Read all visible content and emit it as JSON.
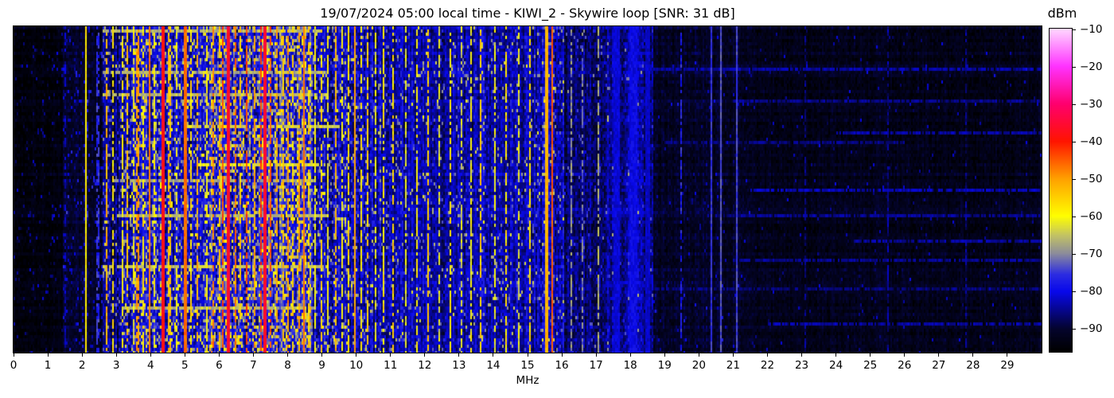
{
  "title": "19/07/2024 05:00 local time - KIWI_2 - Skywire loop [SNR: 31 dB]",
  "x_axis": {
    "label": "MHz",
    "ticks": [
      "0",
      "1",
      "2",
      "3",
      "4",
      "5",
      "6",
      "7",
      "8",
      "9",
      "10",
      "11",
      "12",
      "13",
      "14",
      "15",
      "16",
      "17",
      "18",
      "19",
      "20",
      "21",
      "22",
      "23",
      "24",
      "25",
      "26",
      "27",
      "28",
      "29"
    ]
  },
  "colorbar": {
    "label": "dBm",
    "ticks": [
      "−10",
      "−20",
      "−30",
      "−40",
      "−50",
      "−60",
      "−70",
      "−80",
      "−90"
    ]
  },
  "chart_data": {
    "type": "heatmap",
    "title": "19/07/2024 05:00 local time - KIWI_2 - Skywire loop [SNR: 31 dB]",
    "xlabel": "MHz",
    "colorbar_label": "dBm",
    "x_range": [
      0,
      30
    ],
    "value_range_dbm": [
      -96,
      -10
    ],
    "colorbar_tick_values": [
      -10,
      -20,
      -30,
      -40,
      -50,
      -60,
      -70,
      -80,
      -90
    ],
    "grid": false,
    "description": "HF waterfall spectrogram 0-30 MHz. Quiet/dark below 1.5 MHz and above 18.7 MHz; dense strong broadcast/ham signals 2.6-8.7 MHz (yellow/orange/red, strongest ~4.3, 6.3 and 7.3 MHz); moderate blue noise with many narrow carriers 8.7-18.6 MHz; sparse faint horizontal interference streaks 18.5-30 MHz.",
    "cols": 646,
    "rows": 103,
    "seed": 1234567,
    "colormap_stops": [
      [
        0.0,
        0,
        0,
        0
      ],
      [
        0.07,
        4,
        4,
        45
      ],
      [
        0.186,
        8,
        8,
        235
      ],
      [
        0.24,
        45,
        45,
        225
      ],
      [
        0.304,
        140,
        140,
        155
      ],
      [
        0.36,
        195,
        195,
        100
      ],
      [
        0.42,
        255,
        255,
        0
      ],
      [
        0.536,
        255,
        160,
        0
      ],
      [
        0.652,
        255,
        20,
        0
      ],
      [
        0.768,
        255,
        0,
        110
      ],
      [
        0.884,
        255,
        50,
        255
      ],
      [
        1.0,
        255,
        215,
        255
      ]
    ],
    "noise_bands": [
      {
        "from": 0.0,
        "to": 1.45,
        "base": -94.0,
        "col_var": 1.0,
        "noise": 1.8,
        "spike_p": 0.05,
        "spike_amp": 8
      },
      {
        "from": 1.45,
        "to": 2.05,
        "base": -90.5,
        "col_var": 1.5,
        "noise": 2.5,
        "spike_p": 0.1,
        "spike_amp": 9
      },
      {
        "from": 2.05,
        "to": 2.6,
        "base": -91.0,
        "col_var": 1.5,
        "noise": 2.5,
        "spike_p": 0.09,
        "spike_amp": 10
      },
      {
        "from": 2.6,
        "to": 3.15,
        "base": -86.0,
        "col_var": 3.0,
        "noise": 4.0,
        "spike_p": 0.16,
        "spike_amp": 12
      },
      {
        "from": 3.15,
        "to": 4.65,
        "base": -81.0,
        "col_var": 5.0,
        "noise": 5.0,
        "spike_p": 0.25,
        "spike_amp": 14
      },
      {
        "from": 4.65,
        "to": 5.55,
        "base": -82.0,
        "col_var": 5.0,
        "noise": 5.0,
        "spike_p": 0.22,
        "spike_amp": 14
      },
      {
        "from": 5.55,
        "to": 7.75,
        "base": -79.0,
        "col_var": 6.0,
        "noise": 6.0,
        "spike_p": 0.3,
        "spike_amp": 14
      },
      {
        "from": 7.75,
        "to": 8.7,
        "base": -78.0,
        "col_var": 6.0,
        "noise": 6.0,
        "spike_p": 0.32,
        "spike_amp": 14
      },
      {
        "from": 8.7,
        "to": 10.2,
        "base": -82.0,
        "col_var": 4.0,
        "noise": 5.0,
        "spike_p": 0.18,
        "spike_amp": 13
      },
      {
        "from": 10.2,
        "to": 11.2,
        "base": -82.5,
        "col_var": 4.0,
        "noise": 4.5,
        "spike_p": 0.12,
        "spike_amp": 12
      },
      {
        "from": 11.2,
        "to": 15.35,
        "base": -83.5,
        "col_var": 3.5,
        "noise": 4.0,
        "spike_p": 0.09,
        "spike_amp": 12
      },
      {
        "from": 15.35,
        "to": 16.05,
        "base": -82.0,
        "col_var": 4.0,
        "noise": 5.0,
        "spike_p": 0.12,
        "spike_amp": 12
      },
      {
        "from": 16.05,
        "to": 17.25,
        "base": -86.5,
        "col_var": 3.0,
        "noise": 4.0,
        "spike_p": 0.05,
        "spike_amp": 10
      },
      {
        "from": 17.25,
        "to": 18.65,
        "base": -84.0,
        "col_var": 3.0,
        "noise": 4.0,
        "spike_p": 0.04,
        "spike_amp": 9
      },
      {
        "from": 18.65,
        "to": 21.3,
        "base": -91.0,
        "col_var": 1.5,
        "noise": 2.5,
        "spike_p": 0.02,
        "spike_amp": 8
      },
      {
        "from": 21.3,
        "to": 30.0,
        "base": -92.5,
        "col_var": 1.2,
        "noise": 2.2,
        "spike_p": 0.015,
        "spike_amp": 8
      }
    ],
    "signals": [
      {
        "f": 1.51,
        "w": 0.06,
        "level": -83,
        "solid": 0
      },
      {
        "f": 2.1,
        "w": 0.06,
        "level": -58,
        "solid": 1
      },
      {
        "f": 2.46,
        "w": 0.05,
        "level": -76,
        "solid": 0
      },
      {
        "f": 2.71,
        "w": 0.05,
        "level": -52,
        "solid": 0
      },
      {
        "f": 2.9,
        "w": 0.04,
        "level": -57,
        "solid": 0
      },
      {
        "f": 3.2,
        "w": 0.05,
        "level": -59,
        "solid": 0
      },
      {
        "f": 3.33,
        "w": 0.04,
        "level": -54,
        "solid": 0
      },
      {
        "f": 3.5,
        "w": 0.05,
        "level": -61,
        "solid": 0
      },
      {
        "f": 3.62,
        "w": 0.06,
        "level": -50,
        "solid": 0
      },
      {
        "f": 3.8,
        "w": 0.05,
        "level": -57,
        "solid": 0
      },
      {
        "f": 3.96,
        "w": 0.07,
        "level": -47,
        "solid": 1
      },
      {
        "f": 4.12,
        "w": 0.04,
        "level": -59,
        "solid": 0
      },
      {
        "f": 4.36,
        "w": 0.09,
        "level": -38,
        "solid": 1
      },
      {
        "f": 4.55,
        "w": 0.05,
        "level": -54,
        "solid": 0
      },
      {
        "f": 4.78,
        "w": 0.04,
        "level": -61,
        "solid": 0
      },
      {
        "f": 5.02,
        "w": 0.06,
        "level": -46,
        "solid": 1
      },
      {
        "f": 5.18,
        "w": 0.04,
        "level": -57,
        "solid": 0
      },
      {
        "f": 5.37,
        "w": 0.05,
        "level": -52,
        "solid": 0
      },
      {
        "f": 5.62,
        "w": 0.04,
        "level": -59,
        "solid": 0
      },
      {
        "f": 5.82,
        "w": 0.05,
        "level": -48,
        "solid": 0
      },
      {
        "f": 6.02,
        "w": 0.05,
        "level": -54,
        "solid": 0
      },
      {
        "f": 6.12,
        "w": 0.04,
        "level": -44,
        "solid": 0
      },
      {
        "f": 6.28,
        "w": 0.1,
        "level": -36,
        "solid": 1
      },
      {
        "f": 6.47,
        "w": 0.05,
        "level": -47,
        "solid": 0
      },
      {
        "f": 6.62,
        "w": 0.04,
        "level": -54,
        "solid": 0
      },
      {
        "f": 6.82,
        "w": 0.05,
        "level": -44,
        "solid": 0
      },
      {
        "f": 7.02,
        "w": 0.04,
        "level": -51,
        "solid": 0
      },
      {
        "f": 7.22,
        "w": 0.05,
        "level": -42,
        "solid": 0
      },
      {
        "f": 7.35,
        "w": 0.09,
        "level": -36,
        "solid": 1
      },
      {
        "f": 7.52,
        "w": 0.05,
        "level": -45,
        "solid": 0
      },
      {
        "f": 7.67,
        "w": 0.04,
        "level": -52,
        "solid": 0
      },
      {
        "f": 7.87,
        "w": 0.05,
        "level": -54,
        "solid": 0
      },
      {
        "f": 8.02,
        "w": 0.04,
        "level": -49,
        "solid": 0
      },
      {
        "f": 8.17,
        "w": 0.05,
        "level": -56,
        "solid": 0
      },
      {
        "f": 8.32,
        "w": 0.05,
        "level": -51,
        "solid": 0
      },
      {
        "f": 8.49,
        "w": 0.06,
        "level": -47,
        "solid": 1
      },
      {
        "f": 8.62,
        "w": 0.04,
        "level": -56,
        "solid": 0
      },
      {
        "f": 8.8,
        "w": 0.04,
        "level": -60,
        "solid": 0
      },
      {
        "f": 8.97,
        "w": 0.04,
        "level": -56,
        "solid": 0
      },
      {
        "f": 9.17,
        "w": 0.04,
        "level": -60,
        "solid": 0
      },
      {
        "f": 9.38,
        "w": 0.04,
        "level": -53,
        "solid": 0
      },
      {
        "f": 9.58,
        "w": 0.03,
        "level": -60,
        "solid": 0
      },
      {
        "f": 9.78,
        "w": 0.03,
        "level": -57,
        "solid": 0
      },
      {
        "f": 9.98,
        "w": 0.05,
        "level": -50,
        "solid": 1
      },
      {
        "f": 10.15,
        "w": 0.04,
        "level": -58,
        "solid": 0
      },
      {
        "f": 10.35,
        "w": 0.04,
        "level": -55,
        "solid": 0
      },
      {
        "f": 10.58,
        "w": 0.03,
        "level": -61,
        "solid": 0
      },
      {
        "f": 10.8,
        "w": 0.03,
        "level": -58,
        "solid": 0
      },
      {
        "f": 11.05,
        "w": 0.04,
        "level": -56,
        "solid": 0
      },
      {
        "f": 11.45,
        "w": 0.03,
        "level": -62,
        "solid": 0
      },
      {
        "f": 11.75,
        "w": 0.03,
        "level": -59,
        "solid": 0
      },
      {
        "f": 12.08,
        "w": 0.04,
        "level": -55,
        "solid": 0
      },
      {
        "f": 12.4,
        "w": 0.03,
        "level": -62,
        "solid": 0
      },
      {
        "f": 12.75,
        "w": 0.03,
        "level": -58,
        "solid": 0
      },
      {
        "f": 13.05,
        "w": 0.03,
        "level": -63,
        "solid": 0
      },
      {
        "f": 13.35,
        "w": 0.03,
        "level": -60,
        "solid": 0
      },
      {
        "f": 13.65,
        "w": 0.04,
        "level": -55,
        "solid": 0
      },
      {
        "f": 14.05,
        "w": 0.03,
        "level": -61,
        "solid": 0
      },
      {
        "f": 14.35,
        "w": 0.03,
        "level": -57,
        "solid": 0
      },
      {
        "f": 14.75,
        "w": 0.03,
        "level": -62,
        "solid": 0
      },
      {
        "f": 15.05,
        "w": 0.04,
        "level": -57,
        "solid": 0
      },
      {
        "f": 15.55,
        "w": 0.08,
        "level": -52,
        "solid": 1
      },
      {
        "f": 15.72,
        "w": 0.07,
        "level": -45,
        "solid": 1
      },
      {
        "f": 16.25,
        "w": 0.03,
        "level": -69,
        "solid": 0
      },
      {
        "f": 16.6,
        "w": 0.03,
        "level": -71,
        "solid": 0
      },
      {
        "f": 17.05,
        "w": 0.03,
        "level": -67,
        "solid": 0
      },
      {
        "f": 17.6,
        "w": 0.18,
        "level": -81,
        "solid": 1
      },
      {
        "f": 18.1,
        "w": 0.22,
        "level": -80,
        "solid": 1
      },
      {
        "f": 18.5,
        "w": 0.12,
        "level": -82,
        "solid": 1
      },
      {
        "f": 19.48,
        "w": 0.04,
        "level": -77,
        "solid": 0
      },
      {
        "f": 20.38,
        "w": 0.05,
        "level": -75,
        "solid": 1
      },
      {
        "f": 20.62,
        "w": 0.04,
        "level": -73,
        "solid": 1
      },
      {
        "f": 21.12,
        "w": 0.05,
        "level": -74,
        "solid": 1
      },
      {
        "f": 23.1,
        "w": 0.03,
        "level": -86,
        "solid": 0
      },
      {
        "f": 25.52,
        "w": 0.03,
        "level": -85,
        "solid": 0
      },
      {
        "f": 27.8,
        "w": 0.03,
        "level": -86,
        "solid": 0
      }
    ],
    "streaks": [
      {
        "row": 0.01,
        "from": 2.6,
        "to": 9.0,
        "level": -66
      },
      {
        "row": 0.14,
        "from": 2.6,
        "to": 9.2,
        "level": -67
      },
      {
        "row": 0.205,
        "from": 2.6,
        "to": 9.2,
        "level": -66
      },
      {
        "row": 0.3,
        "from": 5.0,
        "to": 9.5,
        "level": -64
      },
      {
        "row": 0.425,
        "from": 5.4,
        "to": 9.2,
        "level": -62
      },
      {
        "row": 0.47,
        "from": 2.8,
        "to": 8.8,
        "level": -68
      },
      {
        "row": 0.575,
        "from": 3.0,
        "to": 9.2,
        "level": -66
      },
      {
        "row": 0.735,
        "from": 2.6,
        "to": 9.2,
        "level": -65
      },
      {
        "row": 0.86,
        "from": 3.2,
        "to": 8.8,
        "level": -67
      },
      {
        "row": 0.13,
        "from": 18.5,
        "to": 30.0,
        "level": -84
      },
      {
        "row": 0.225,
        "from": 21.0,
        "to": 30.0,
        "level": -85
      },
      {
        "row": 0.32,
        "from": 24.0,
        "to": 30.0,
        "level": -84
      },
      {
        "row": 0.355,
        "from": 19.0,
        "to": 26.0,
        "level": -86
      },
      {
        "row": 0.5,
        "from": 21.5,
        "to": 30.0,
        "level": -83
      },
      {
        "row": 0.58,
        "from": 20.5,
        "to": 30.0,
        "level": -85
      },
      {
        "row": 0.66,
        "from": 24.5,
        "to": 30.0,
        "level": -84
      },
      {
        "row": 0.72,
        "from": 21.0,
        "to": 30.0,
        "level": -85
      },
      {
        "row": 0.8,
        "from": 18.5,
        "to": 30.0,
        "level": -86
      },
      {
        "row": 0.91,
        "from": 22.0,
        "to": 30.0,
        "level": -84
      }
    ]
  }
}
